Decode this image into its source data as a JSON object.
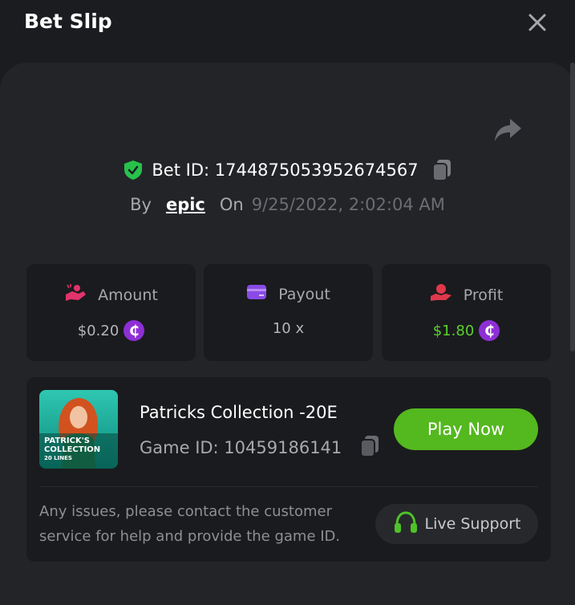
{
  "header": {
    "title": "Bet Slip"
  },
  "bet": {
    "id_text": "Bet ID: 1744875053952674567",
    "by_label": "By",
    "user": "epic",
    "on_label": "On",
    "date": "9/25/2022, 2:02:04 AM"
  },
  "stats": {
    "amount": {
      "label": "Amount",
      "value": "$0.20"
    },
    "payout": {
      "label": "Payout",
      "value": "10 x"
    },
    "profit": {
      "label": "Profit",
      "value": "$1.80"
    },
    "coin_symbol": "₵"
  },
  "game": {
    "name": "Patricks Collection -20E",
    "id_text": "Game ID: 10459186141",
    "thumb_line1": "PATRICK'S",
    "thumb_line2": "COLLECTION",
    "thumb_line3": "20 LINES",
    "play_label": "Play Now"
  },
  "support": {
    "message_line1": "Any issues, please contact the customer",
    "message_line2": "service for help and provide the game ID.",
    "button_label": "Live Support"
  },
  "colors": {
    "background": "#1b1c1f",
    "panel": "#232428",
    "card": "#1a1b1e",
    "accent_green": "#54b81f",
    "profit_green": "#5ad12e",
    "coin_purple": "#8e2fd6",
    "amount_pink": "#e2336b",
    "payout_purple": "#8a4ae6",
    "profit_red": "#e0384a"
  },
  "icons": {
    "close": "close-icon",
    "share": "share-icon",
    "verified": "shield-check-icon",
    "copy": "copy-icon",
    "amount": "coin-hand-icon",
    "payout": "card-icon",
    "profit": "hand-coin-icon",
    "support": "headset-icon"
  }
}
